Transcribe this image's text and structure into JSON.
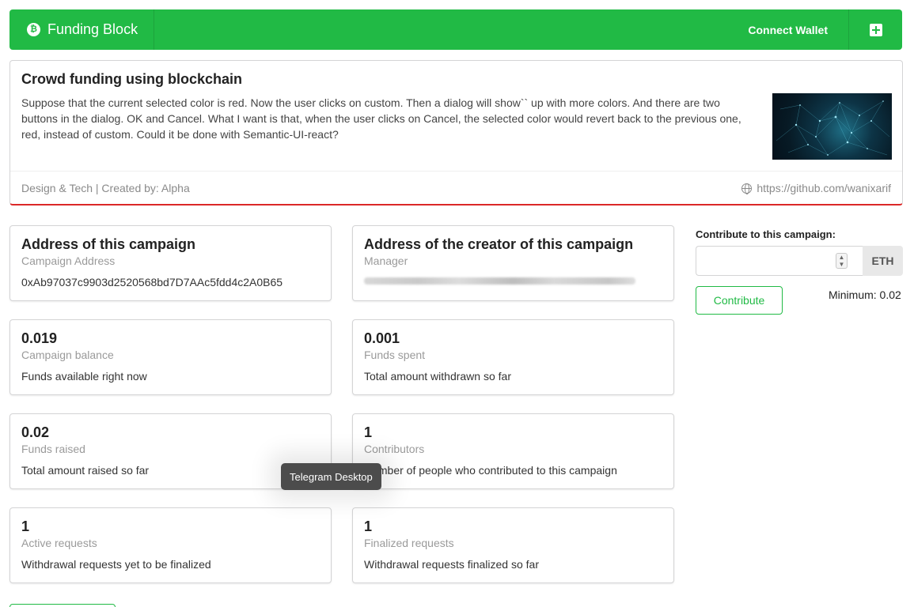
{
  "menu": {
    "brand": "Funding Block",
    "brand_icon": "bitcoin-icon",
    "connect_wallet": "Connect Wallet",
    "plus_icon": "plus-square-icon",
    "accent_color": "#21ba45"
  },
  "campaign": {
    "title": "Crowd funding using blockchain",
    "description": "Suppose that the current selected color is red. Now the user clicks on custom. Then a dialog will show`` up with more colors. And there are two buttons in the dialog. OK and Cancel. What I want is that, when the user clicks on Cancel, the selected color would revert back to the previous one, red, instead of custom. Could it be done with Semantic-UI-react?",
    "footer_left": "Design & Tech | Created by: Alpha",
    "footer_link": "https://github.com/wanixarif",
    "link_icon": "globe-icon",
    "border_color": "#db2828"
  },
  "cards": {
    "address": {
      "header": "Address of this campaign",
      "meta": "Campaign Address",
      "desc": "0xAb97037c9903d2520568bd7D7AAc5fdd4c2A0B65"
    },
    "manager": {
      "header": "Address of the creator of this campaign",
      "meta": "Manager"
    },
    "balance": {
      "header": "0.019",
      "meta": "Campaign balance",
      "desc": "Funds available right now"
    },
    "spent": {
      "header": "0.001",
      "meta": "Funds spent",
      "desc": "Total amount withdrawn so far"
    },
    "raised": {
      "header": "0.02",
      "meta": "Funds raised",
      "desc": "Total amount raised so far"
    },
    "contributors": {
      "header": "1",
      "meta": "Contributors",
      "desc": "Number of people who contributed to this campaign"
    },
    "active": {
      "header": "1",
      "meta": "Active requests",
      "desc": "Withdrawal requests yet to be finalized"
    },
    "finalized": {
      "header": "1",
      "meta": "Finalized requests",
      "desc": "Withdrawal requests finalized so far"
    }
  },
  "form": {
    "label": "Contribute to this campaign:",
    "value": "",
    "unit": "ETH",
    "button": "Contribute",
    "minimum": "Minimum: 0.02"
  },
  "tooltip": "Telegram Desktop"
}
